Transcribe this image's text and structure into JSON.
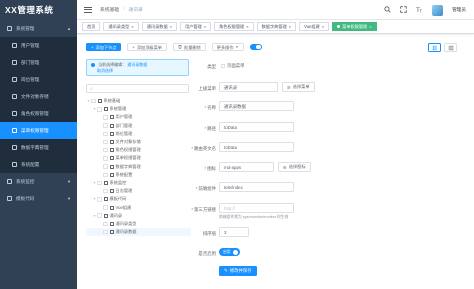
{
  "app": {
    "logo": "XX管理系统"
  },
  "sidebar": {
    "items": [
      {
        "label": "系统管理",
        "level": 1,
        "caret": "▲"
      },
      {
        "label": "用户管理",
        "level": 2
      },
      {
        "label": "部门管理",
        "level": 2
      },
      {
        "label": "岗位管理",
        "level": 2
      },
      {
        "label": "文件对象存储",
        "level": 2
      },
      {
        "label": "角色权限管理",
        "level": 2
      },
      {
        "label": "菜单权限管理",
        "level": 2,
        "active": true
      },
      {
        "label": "数据字典管理",
        "level": 2
      },
      {
        "label": "系统配置",
        "level": 2
      },
      {
        "label": "系统监控",
        "level": 1,
        "caret": "▼"
      },
      {
        "label": "模板代码",
        "level": 1,
        "caret": "▼"
      }
    ]
  },
  "navbar": {
    "breadcrumb": [
      "系统基础",
      "通讯录"
    ],
    "icons": [
      "search-icon",
      "fullscreen-icon",
      "font-size-icon"
    ],
    "username": "管理员"
  },
  "tags": [
    {
      "label": "首页"
    },
    {
      "label": "通讯录类型"
    },
    {
      "label": "通讯录数据"
    },
    {
      "label": "用户管理"
    },
    {
      "label": "角色权限管理"
    },
    {
      "label": "数据字典管理"
    },
    {
      "label": "Vue组建"
    },
    {
      "label": "菜单权限管理",
      "active": true
    }
  ],
  "toolbar": {
    "add_child": "添加下节点",
    "add_top": "添加顶级菜单",
    "batch_delete": "批量删除",
    "more": "更多操作",
    "more_caret": "▼",
    "plus": "+",
    "add_icon": "⊕",
    "delete_icon": "🗑"
  },
  "alert": {
    "prefix": "当前选择编辑：",
    "selected": "通讯录数据",
    "cancel": "取消选择"
  },
  "search": {
    "icon": "⌕"
  },
  "tree": [
    {
      "label": "系统基础",
      "depth": 0,
      "expanded": true
    },
    {
      "label": "系统管理",
      "depth": 1,
      "expanded": true
    },
    {
      "label": "用户管理",
      "depth": 2
    },
    {
      "label": "部门管理",
      "depth": 2
    },
    {
      "label": "岗位管理",
      "depth": 2
    },
    {
      "label": "文件对象存储",
      "depth": 2
    },
    {
      "label": "角色权限管理",
      "depth": 2
    },
    {
      "label": "菜单权限管理",
      "depth": 2
    },
    {
      "label": "数据字典管理",
      "depth": 2
    },
    {
      "label": "系统配置",
      "depth": 2
    },
    {
      "label": "系统监控",
      "depth": 1,
      "expanded": true
    },
    {
      "label": "日志管理",
      "depth": 2
    },
    {
      "label": "模板代码",
      "depth": 1,
      "expanded": true
    },
    {
      "label": "Vue组建",
      "depth": 2
    },
    {
      "label": "通讯录",
      "depth": 1,
      "expanded": true
    },
    {
      "label": "通讯录类型",
      "depth": 2
    },
    {
      "label": "通讯录数据",
      "depth": 2,
      "selected": true
    }
  ],
  "form": {
    "type_label": "类型",
    "type_value": "页面菜单",
    "parent_label": "上级菜单",
    "parent_value": "通讯录",
    "parent_btn": "选择菜单",
    "name_label": "名称",
    "name_value": "通讯录数据",
    "path_label": "路径",
    "path_value": "toData",
    "route_label": "路由英文名",
    "route_value": "toData",
    "icon_label": "图标",
    "icon_value": "md-apps",
    "icon_btn": "选择图标",
    "component_label": "前端组件",
    "component_value": "tele/index",
    "external_label": "第三方链接",
    "external_placeholder": "http://",
    "external_hint": "前端组件需为 sys/monitor/monitor 时生效",
    "order_label": "排序值",
    "order_value": "3",
    "enabled_label": "是否启用",
    "enabled_value": "启用",
    "submit": "修改并保存"
  }
}
